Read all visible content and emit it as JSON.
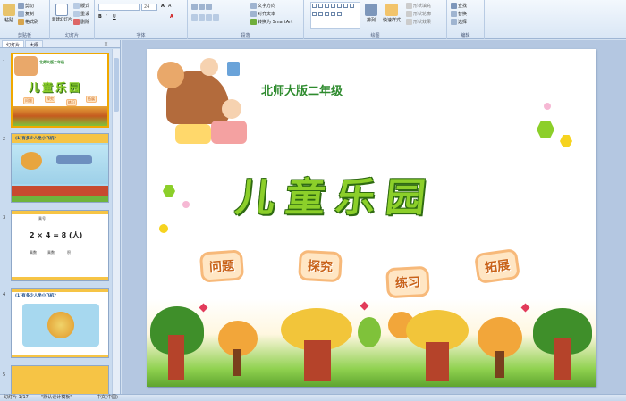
{
  "ribbon": {
    "groups": [
      {
        "label": "剪贴板",
        "buttons": [
          "粘贴",
          "剪切",
          "复制",
          "格式刷"
        ]
      },
      {
        "label": "幻灯片",
        "buttons": [
          "新建幻灯片",
          "版式",
          "重设",
          "删除"
        ]
      },
      {
        "label": "字体",
        "font_size": "24"
      },
      {
        "label": "段落",
        "buttons": [
          "文字方向",
          "对齐文本",
          "转换为 SmartArt"
        ]
      },
      {
        "label": "绘图",
        "buttons": [
          "排列",
          "快速样式",
          "形状填充",
          "形状轮廓",
          "形状效果"
        ]
      },
      {
        "label": "编辑",
        "buttons": [
          "查找",
          "替换",
          "选择"
        ]
      }
    ]
  },
  "pane": {
    "tabs": [
      "幻灯片",
      "大纲"
    ],
    "close": "×",
    "thumbnails": [
      {
        "num": "1",
        "title": "儿童乐园",
        "tags": [
          "问题",
          "探究",
          "练习",
          "拓展"
        ],
        "header": "北师大版二年级"
      },
      {
        "num": "2",
        "title": "(1)有多少人坐小飞机?"
      },
      {
        "num": "3",
        "lines": [
          "乘号",
          "2 × 4 = 8 (人)",
          "乘数",
          "乘数",
          "积"
        ]
      },
      {
        "num": "4",
        "title": "(1)有多少人坐小飞机?"
      },
      {
        "num": "5"
      }
    ]
  },
  "slide": {
    "subtitle": "北师大版二年级",
    "title": "儿童乐园",
    "tags": [
      "问题",
      "探究",
      "练习",
      "拓展"
    ]
  },
  "status": {
    "slide_info": "幻灯片 1/17",
    "theme": "\"默认设计模板\"",
    "language": "中文(中国)"
  },
  "colors": {
    "accent": "#8ccf2a",
    "title_outline": "#2f6b12",
    "tag_bg": "#ffe6c4",
    "tag_border": "#f7b97a",
    "selection": "#f0a800"
  }
}
